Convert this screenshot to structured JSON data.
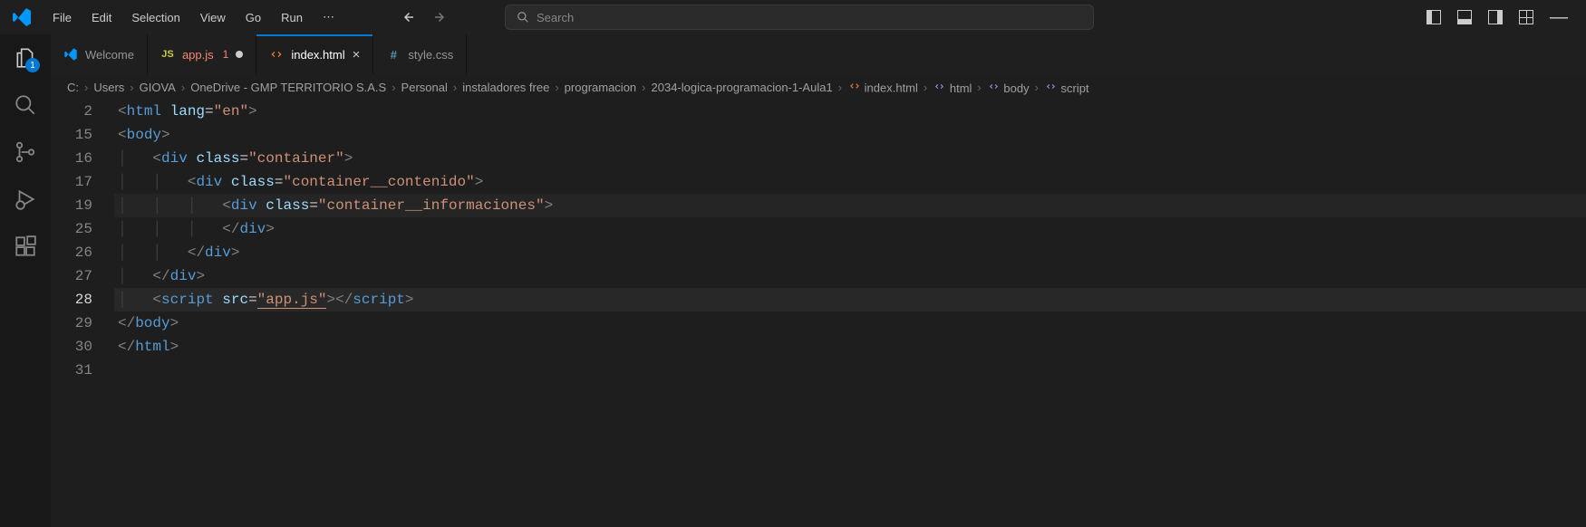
{
  "menu": {
    "file": "File",
    "edit": "Edit",
    "selection": "Selection",
    "view": "View",
    "go": "Go",
    "run": "Run",
    "ellipsis": "⋯"
  },
  "search": {
    "placeholder": "Search"
  },
  "activity": {
    "explorer_badge": "1"
  },
  "tabs": {
    "welcome": "Welcome",
    "appjs": "app.js",
    "appjs_problems": "1",
    "index": "index.html",
    "style": "style.css"
  },
  "breadcrumbs": {
    "items": [
      "C:",
      "Users",
      "GIOVA",
      "OneDrive - GMP TERRITORIO S.A.S",
      "Personal",
      "instaladores free",
      "programacion",
      "2034-logica-programacion-1-Aula1"
    ],
    "file": "index.html",
    "nodes": [
      "html",
      "body",
      "script"
    ]
  },
  "code": {
    "lines": [
      {
        "n": "2",
        "indent": 0,
        "tokens": [
          {
            "k": "bracket",
            "t": "<"
          },
          {
            "k": "tag",
            "t": "html"
          },
          {
            "k": "plain",
            "t": " "
          },
          {
            "k": "attr",
            "t": "lang"
          },
          {
            "k": "plain",
            "t": "="
          },
          {
            "k": "str",
            "t": "\"en\""
          },
          {
            "k": "bracket",
            "t": ">"
          }
        ]
      },
      {
        "n": "15",
        "indent": 0,
        "tokens": [
          {
            "k": "bracket",
            "t": "<"
          },
          {
            "k": "tag",
            "t": "body"
          },
          {
            "k": "bracket",
            "t": ">"
          }
        ]
      },
      {
        "n": "16",
        "indent": 1,
        "tokens": [
          {
            "k": "bracket",
            "t": "<"
          },
          {
            "k": "tag",
            "t": "div"
          },
          {
            "k": "plain",
            "t": " "
          },
          {
            "k": "attr",
            "t": "class"
          },
          {
            "k": "plain",
            "t": "="
          },
          {
            "k": "str",
            "t": "\"container\""
          },
          {
            "k": "bracket",
            "t": ">"
          }
        ]
      },
      {
        "n": "17",
        "indent": 2,
        "tokens": [
          {
            "k": "bracket",
            "t": "<"
          },
          {
            "k": "tag",
            "t": "div"
          },
          {
            "k": "plain",
            "t": " "
          },
          {
            "k": "attr",
            "t": "class"
          },
          {
            "k": "plain",
            "t": "="
          },
          {
            "k": "str",
            "t": "\"container__contenido\""
          },
          {
            "k": "bracket",
            "t": ">"
          }
        ]
      },
      {
        "n": "19",
        "indent": 3,
        "sticky": true,
        "tokens": [
          {
            "k": "bracket",
            "t": "<"
          },
          {
            "k": "tag",
            "t": "div"
          },
          {
            "k": "plain",
            "t": " "
          },
          {
            "k": "attr",
            "t": "class"
          },
          {
            "k": "plain",
            "t": "="
          },
          {
            "k": "str",
            "t": "\"container__informaciones\""
          },
          {
            "k": "bracket",
            "t": ">"
          }
        ]
      },
      {
        "n": "25",
        "indent": 3,
        "tokens": [
          {
            "k": "bracket",
            "t": "</"
          },
          {
            "k": "tag",
            "t": "div"
          },
          {
            "k": "bracket",
            "t": ">"
          }
        ]
      },
      {
        "n": "26",
        "indent": 2,
        "tokens": [
          {
            "k": "bracket",
            "t": "</"
          },
          {
            "k": "tag",
            "t": "div"
          },
          {
            "k": "bracket",
            "t": ">"
          }
        ]
      },
      {
        "n": "27",
        "indent": 1,
        "tokens": [
          {
            "k": "bracket",
            "t": "</"
          },
          {
            "k": "tag",
            "t": "div"
          },
          {
            "k": "bracket",
            "t": ">"
          }
        ]
      },
      {
        "n": "28",
        "indent": 1,
        "active": true,
        "tokens": [
          {
            "k": "bracket",
            "t": "<"
          },
          {
            "k": "tag",
            "t": "script"
          },
          {
            "k": "plain",
            "t": " "
          },
          {
            "k": "attr",
            "t": "src"
          },
          {
            "k": "plain",
            "t": "="
          },
          {
            "k": "strlink",
            "t": "\"app.js\""
          },
          {
            "k": "bracket",
            "t": "></"
          },
          {
            "k": "tag",
            "t": "script"
          },
          {
            "k": "bracket",
            "t": ">"
          }
        ]
      },
      {
        "n": "29",
        "indent": 0,
        "tokens": [
          {
            "k": "bracket",
            "t": "</"
          },
          {
            "k": "tag",
            "t": "body"
          },
          {
            "k": "bracket",
            "t": ">"
          }
        ]
      },
      {
        "n": "30",
        "indent": 0,
        "tokens": [
          {
            "k": "bracket",
            "t": "</"
          },
          {
            "k": "tag",
            "t": "html"
          },
          {
            "k": "bracket",
            "t": ">"
          }
        ]
      },
      {
        "n": "31",
        "indent": 0,
        "tokens": []
      }
    ]
  }
}
